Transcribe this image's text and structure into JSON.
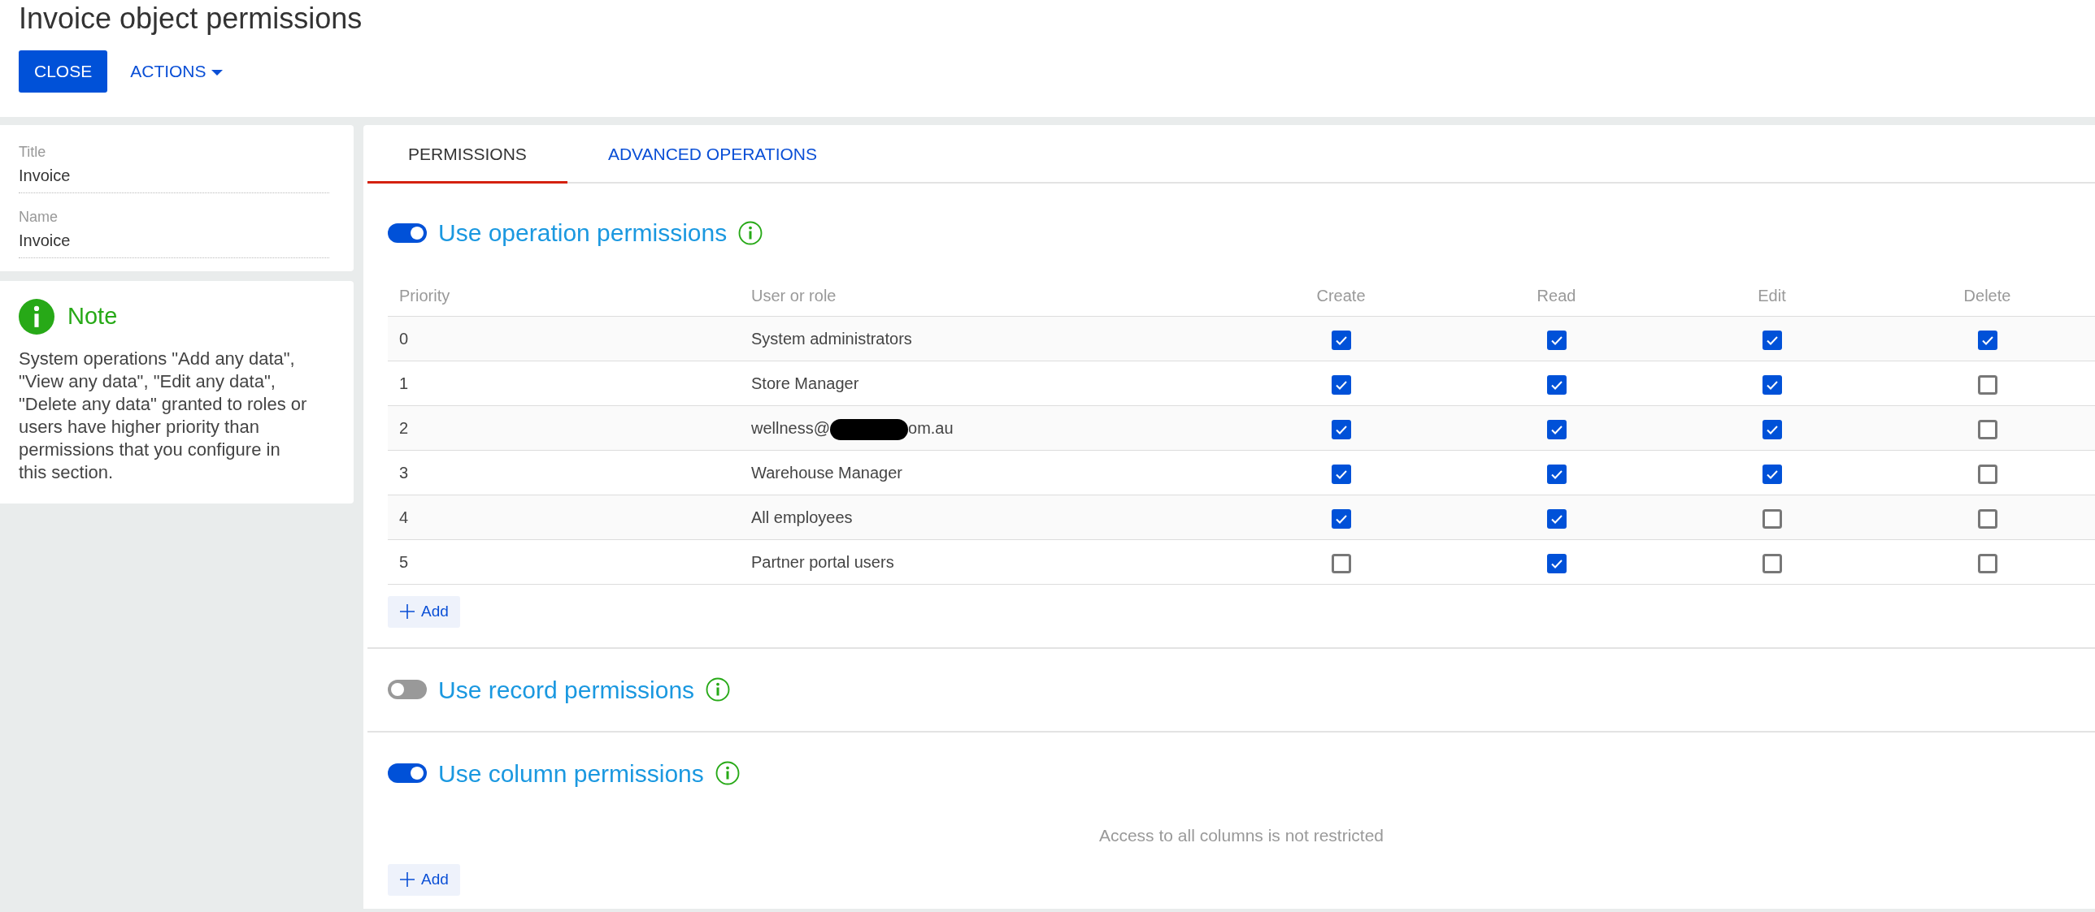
{
  "page": {
    "title": "Invoice object permissions"
  },
  "toolbar": {
    "close": "CLOSE",
    "actions": "ACTIONS"
  },
  "fields": [
    {
      "label": "Title",
      "value": "Invoice"
    },
    {
      "label": "Name",
      "value": "Invoice"
    }
  ],
  "note": {
    "title": "Note",
    "text": "System operations \"Add any data\", \"View any data\", \"Edit any data\", \"Delete any data\" granted to roles or users have higher priority than permissions that you configure in this section."
  },
  "tabs": [
    {
      "label": "PERMISSIONS",
      "selected": true
    },
    {
      "label": "ADVANCED OPERATIONS",
      "selected": false
    }
  ],
  "operation_permissions": {
    "title": "Use operation permissions",
    "on": true,
    "table": {
      "columns": [
        "Priority",
        "User or role",
        "Create",
        "Read",
        "Edit",
        "Delete"
      ],
      "rows": [
        {
          "priority": "0",
          "user": "System administrators",
          "checks": [
            true,
            true,
            true,
            true
          ]
        },
        {
          "priority": "1",
          "user": "Store Manager",
          "checks": [
            true,
            true,
            true,
            false
          ]
        },
        {
          "priority": "2",
          "user": "wellness@",
          "redacted": true,
          "user_tail": "om.au",
          "checks": [
            true,
            true,
            true,
            false
          ]
        },
        {
          "priority": "3",
          "user": "Warehouse Manager",
          "checks": [
            true,
            true,
            true,
            false
          ]
        },
        {
          "priority": "4",
          "user": "All employees",
          "checks": [
            true,
            true,
            false,
            false
          ]
        },
        {
          "priority": "5",
          "user": "Partner portal users",
          "checks": [
            false,
            true,
            false,
            false
          ]
        }
      ]
    },
    "add": "Add"
  },
  "record_permissions": {
    "title": "Use record permissions",
    "on": false
  },
  "column_permissions": {
    "title": "Use column permissions",
    "on": true,
    "empty": "Access to all columns is not restricted",
    "add": "Add"
  }
}
